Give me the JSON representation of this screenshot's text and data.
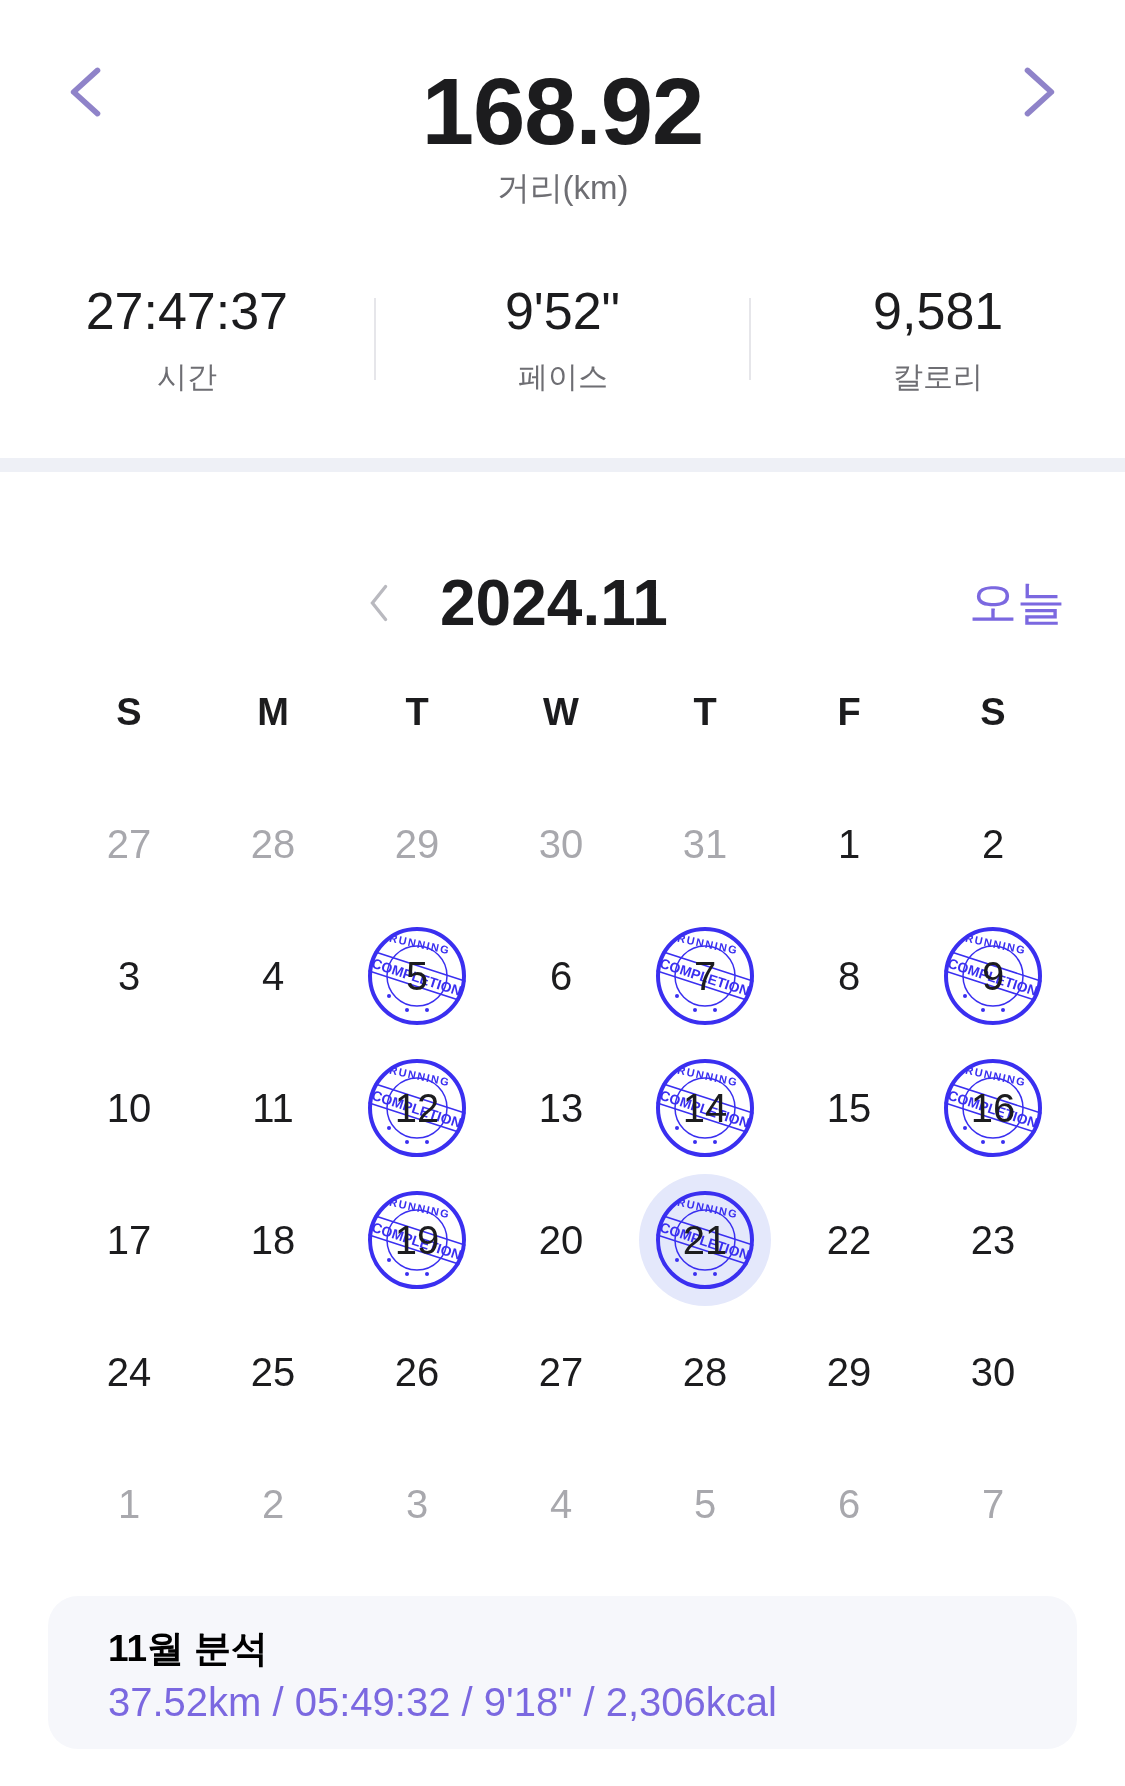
{
  "summary": {
    "distance": "168.92",
    "distance_label": "거리(km)",
    "stats": [
      {
        "value": "27:47:37",
        "label": "시간"
      },
      {
        "value": "9'52\"",
        "label": "페이스"
      },
      {
        "value": "9,581",
        "label": "칼로리"
      }
    ]
  },
  "calendar": {
    "month": "2024.11",
    "today_button": "오늘",
    "weekdays": [
      "S",
      "M",
      "T",
      "W",
      "T",
      "F",
      "S"
    ],
    "days": [
      {
        "day": "27",
        "in_month": false,
        "selected": false
      },
      {
        "day": "28",
        "in_month": false,
        "selected": false
      },
      {
        "day": "29",
        "in_month": false,
        "selected": false
      },
      {
        "day": "30",
        "in_month": false,
        "selected": false
      },
      {
        "day": "31",
        "in_month": false,
        "selected": false
      },
      {
        "day": "1",
        "in_month": true,
        "selected": false
      },
      {
        "day": "2",
        "in_month": true,
        "selected": false
      },
      {
        "day": "3",
        "in_month": true,
        "selected": false
      },
      {
        "day": "4",
        "in_month": true,
        "selected": false
      },
      {
        "day": "5",
        "in_month": true,
        "selected": false,
        "stamp": {
          "top": "RUNNING",
          "band": "COMPLETION"
        }
      },
      {
        "day": "6",
        "in_month": true,
        "selected": false
      },
      {
        "day": "7",
        "in_month": true,
        "selected": false,
        "stamp": {
          "top": "RUNNING",
          "band": "COMPLETION"
        }
      },
      {
        "day": "8",
        "in_month": true,
        "selected": false
      },
      {
        "day": "9",
        "in_month": true,
        "selected": false,
        "stamp": {
          "top": "RUNNING",
          "band": "COMPLETION"
        }
      },
      {
        "day": "10",
        "in_month": true,
        "selected": false
      },
      {
        "day": "11",
        "in_month": true,
        "selected": false
      },
      {
        "day": "12",
        "in_month": true,
        "selected": false,
        "stamp": {
          "top": "RUNNING",
          "band": "COMPLETION"
        }
      },
      {
        "day": "13",
        "in_month": true,
        "selected": false
      },
      {
        "day": "14",
        "in_month": true,
        "selected": false,
        "stamp": {
          "top": "RUNNING",
          "band": "COMPLETION"
        }
      },
      {
        "day": "15",
        "in_month": true,
        "selected": false
      },
      {
        "day": "16",
        "in_month": true,
        "selected": false,
        "stamp": {
          "top": "RUNNING",
          "band": "COMPLETION"
        }
      },
      {
        "day": "17",
        "in_month": true,
        "selected": false
      },
      {
        "day": "18",
        "in_month": true,
        "selected": false
      },
      {
        "day": "19",
        "in_month": true,
        "selected": false,
        "stamp": {
          "top": "RUNNING",
          "band": "COMPLETION"
        }
      },
      {
        "day": "20",
        "in_month": true,
        "selected": false
      },
      {
        "day": "21",
        "in_month": true,
        "selected": true,
        "stamp": {
          "top": "RUNNING",
          "band": "COMPLETION"
        }
      },
      {
        "day": "22",
        "in_month": true,
        "selected": false
      },
      {
        "day": "23",
        "in_month": true,
        "selected": false
      },
      {
        "day": "24",
        "in_month": true,
        "selected": false
      },
      {
        "day": "25",
        "in_month": true,
        "selected": false
      },
      {
        "day": "26",
        "in_month": true,
        "selected": false
      },
      {
        "day": "27",
        "in_month": true,
        "selected": false
      },
      {
        "day": "28",
        "in_month": true,
        "selected": false
      },
      {
        "day": "29",
        "in_month": true,
        "selected": false
      },
      {
        "day": "30",
        "in_month": true,
        "selected": false
      },
      {
        "day": "1",
        "in_month": false,
        "selected": false
      },
      {
        "day": "2",
        "in_month": false,
        "selected": false
      },
      {
        "day": "3",
        "in_month": false,
        "selected": false
      },
      {
        "day": "4",
        "in_month": false,
        "selected": false
      },
      {
        "day": "5",
        "in_month": false,
        "selected": false
      },
      {
        "day": "6",
        "in_month": false,
        "selected": false
      },
      {
        "day": "7",
        "in_month": false,
        "selected": false
      }
    ]
  },
  "analysis": {
    "title": "11월 분석",
    "detail": "37.52km / 05:49:32 / 9'18\" / 2,306kcal"
  }
}
